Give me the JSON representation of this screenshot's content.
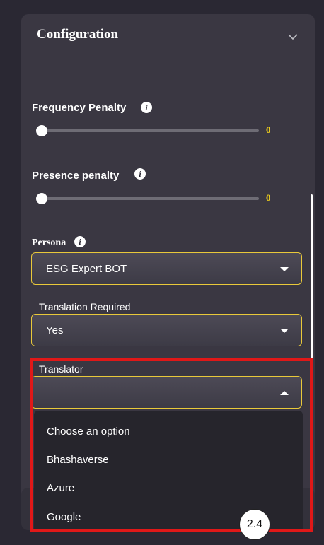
{
  "config": {
    "title": "Configuration",
    "frequency_penalty": {
      "label": "Frequency Penalty",
      "value": "0"
    },
    "presence_penalty": {
      "label": "Presence penalty",
      "value": "0"
    },
    "persona": {
      "label": "Persona",
      "value": "ESG Expert BOT"
    },
    "translation_required": {
      "label": "Translation Required",
      "value": "Yes"
    },
    "translator": {
      "label": "Translator",
      "value": "",
      "options": [
        "Choose an option",
        "Bhashaverse",
        "Azure",
        "Google"
      ]
    }
  },
  "annotation": {
    "step": "2.4",
    "color": "#e01818"
  },
  "colors": {
    "accent": "#e9c93a",
    "value_text": "#f2d21b"
  }
}
